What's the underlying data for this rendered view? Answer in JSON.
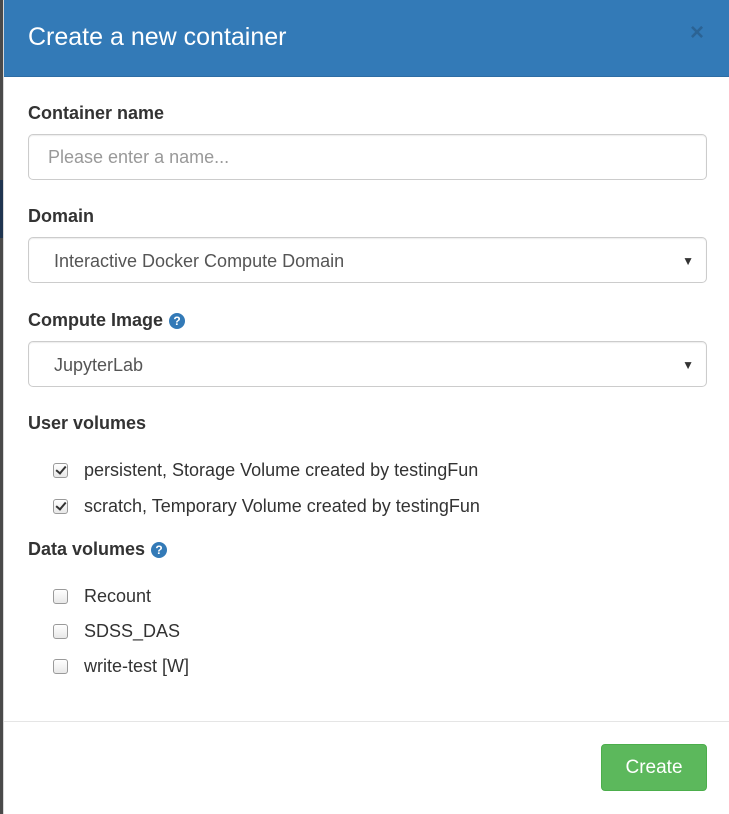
{
  "dialog": {
    "title": "Create a new container",
    "close_label": "×"
  },
  "form": {
    "container_name": {
      "label": "Container name",
      "value": "",
      "placeholder": "Please enter a name..."
    },
    "domain": {
      "label": "Domain",
      "selected": "Interactive Docker Compute Domain"
    },
    "compute_image": {
      "label": "Compute Image",
      "selected": "JupyterLab",
      "help_icon": "question-circle-icon"
    },
    "user_volumes": {
      "label": "User volumes",
      "items": [
        {
          "label": "persistent, Storage Volume created by testingFun",
          "checked": true
        },
        {
          "label": "scratch, Temporary Volume created by testingFun",
          "checked": true
        }
      ]
    },
    "data_volumes": {
      "label": "Data volumes",
      "help_icon": "question-circle-icon",
      "items": [
        {
          "label": "Recount",
          "checked": false
        },
        {
          "label": "SDSS_DAS",
          "checked": false
        },
        {
          "label": "write-test [W]",
          "checked": false
        }
      ]
    }
  },
  "footer": {
    "create_label": "Create"
  },
  "colors": {
    "header_bg": "#337ab7",
    "create_button_bg": "#5cb85c",
    "help_icon": "#337ab7"
  }
}
